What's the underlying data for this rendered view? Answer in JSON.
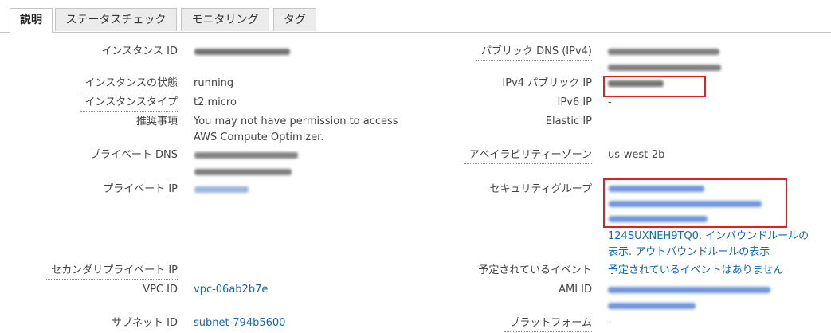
{
  "tabs": [
    "説明",
    "ステータスチェック",
    "モニタリング",
    "タグ"
  ],
  "left": {
    "instance_id_label": "インスタンス ID",
    "state_label": "インスタンスの状態",
    "state_value": "running",
    "type_label": "インスタンスタイプ",
    "type_value": "t2.micro",
    "recommend_label": "推奨事項",
    "recommend_line1": "You may not have permission to access",
    "recommend_line2": "AWS Compute Optimizer.",
    "private_dns_label": "プライベート DNS",
    "private_ip_label": "プライベート IP",
    "secondary_ip_label": "セカンダリプライベート IP",
    "vpc_label": "VPC ID",
    "vpc_value": "vpc-06ab2b7e",
    "subnet_label": "サブネット ID",
    "subnet_value": "subnet-794b5600"
  },
  "right": {
    "public_dns_label": "パブリック DNS (IPv4)",
    "ipv4_public_label": "IPv4 パブリック IP",
    "ipv6_label": "IPv6 IP",
    "ipv6_value": "-",
    "elastic_label": "Elastic IP",
    "az_label": "アベイラビリティーゾーン",
    "az_value": "us-west-2b",
    "sg_label": "セキュリティグループ",
    "sg_line4": "124SUXNEH9TQ0. インバウンドルールの",
    "sg_line5": "表示. アウトバウンドルールの表示",
    "events_label": "予定されているイベント",
    "events_value": "予定されているイベントはありません",
    "ami_label": "AMI ID",
    "platform_label": "プラットフォーム",
    "platform_value": "-"
  },
  "colors": {
    "link": "#1166bb",
    "highlight_box": "#e02020"
  }
}
